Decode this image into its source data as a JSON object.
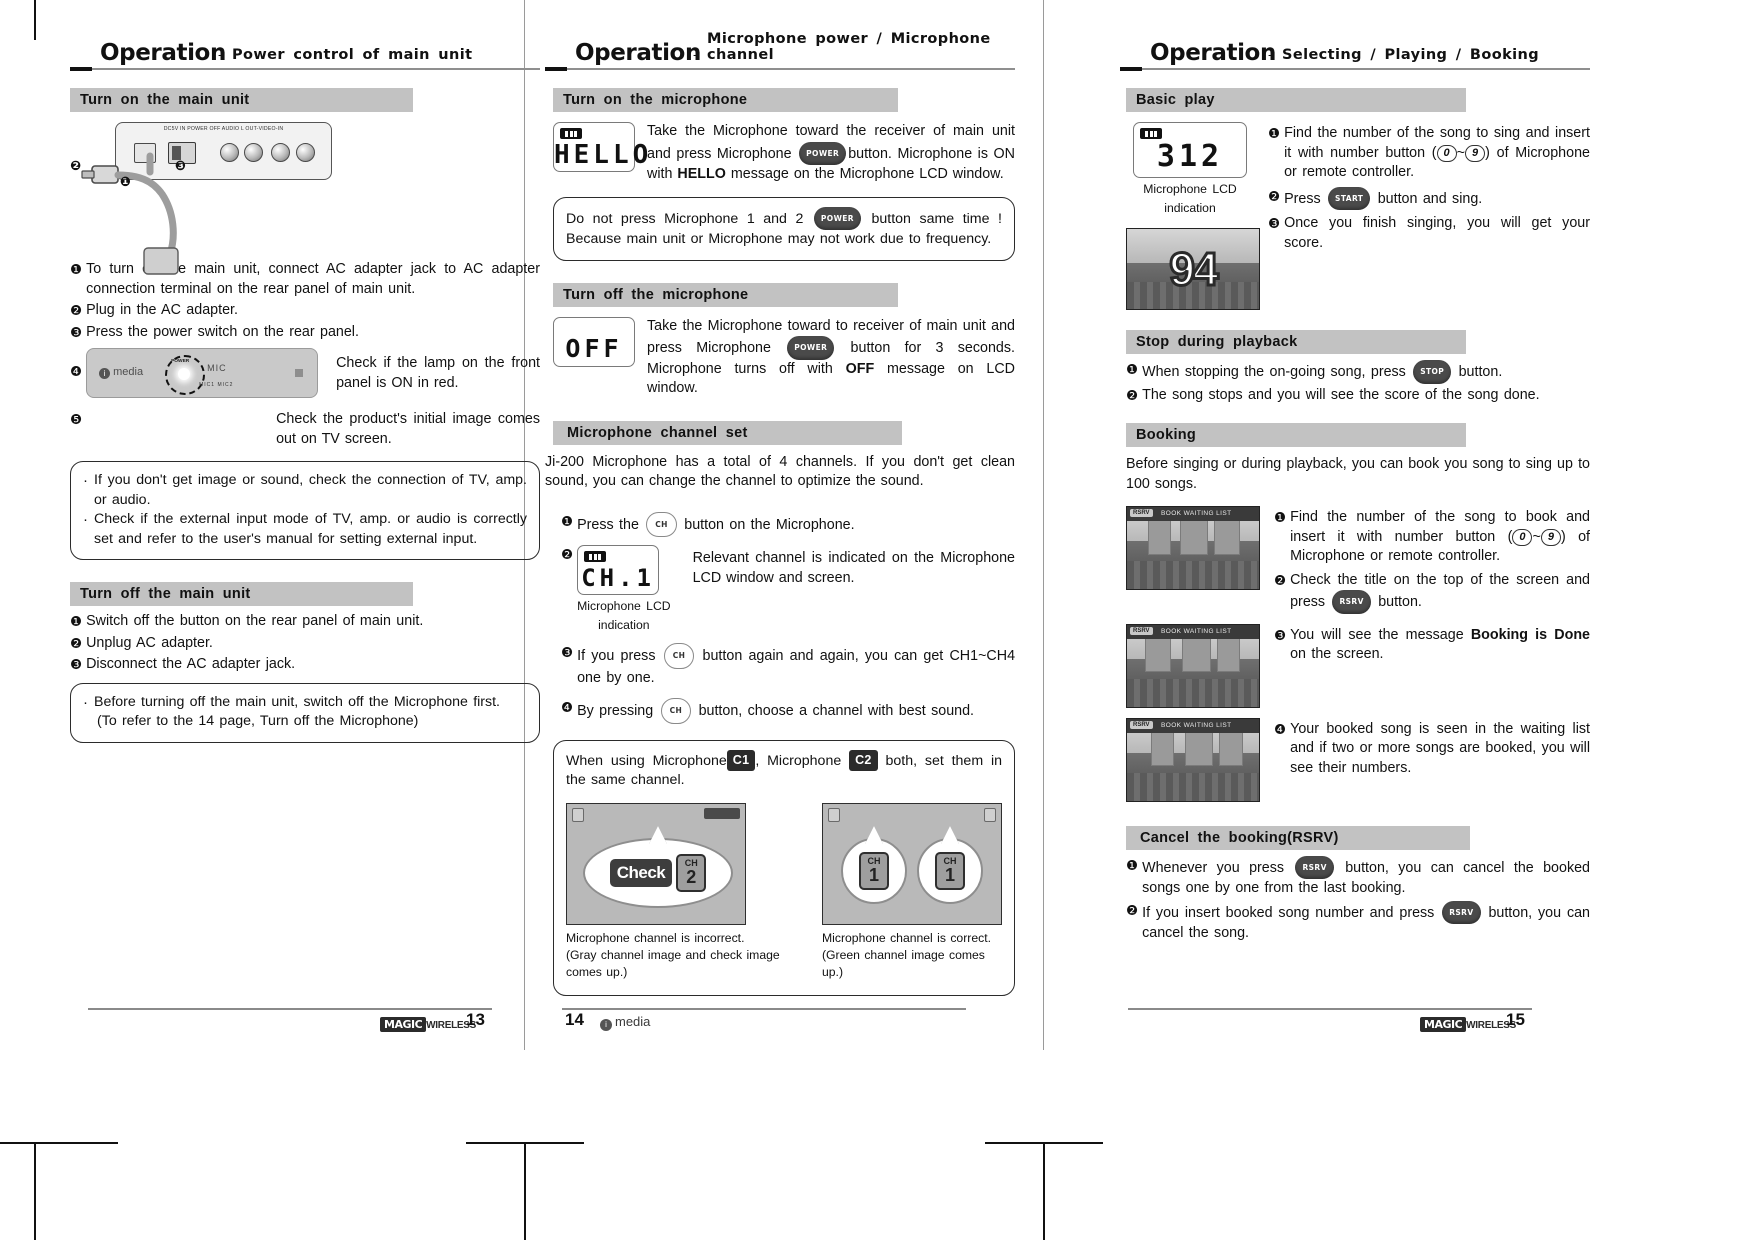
{
  "page13": {
    "header": {
      "title": "Operation",
      "dash": "-",
      "subtitle": "Power control of main unit"
    },
    "section_on": "Turn on the main unit",
    "steps_on": [
      "To turn on the main unit, connect AC adapter jack to AC adapter connection terminal on the rear panel of main unit.",
      "Plug in the AC adapter.",
      "Press the power switch on the rear panel.",
      "Check if the lamp on the front panel is ON in red.",
      "Check the product's initial image comes out on TV screen."
    ],
    "rear_panel_labels": "DC5V IN   POWER  OFF      AUDIO  L      OUT-VIDEO-IN",
    "front_panel": {
      "brand": "media",
      "power_label": "POWER",
      "mic_label": "MIC",
      "mic_sub": "MIC1  MIC2"
    },
    "note_on": [
      "If you don't get image or sound, check the connection of TV, amp. or audio.",
      "Check if the external input mode of TV, amp. or audio is correctly set and refer to the user's manual for setting external input."
    ],
    "section_off": "Turn off the main unit",
    "steps_off": [
      "Switch off the button on the rear panel of main unit.",
      "Unplug AC adapter.",
      "Disconnect the AC adapter jack."
    ],
    "note_off_line1": "Before turning off the main unit, switch off the Microphone first.",
    "note_off_line2": "(To refer to the 14 page, Turn off the Microphone)",
    "footer": {
      "brand": "MAGIC",
      "brand2": "WIRELESS",
      "number": "13"
    }
  },
  "page14": {
    "header": {
      "title": "Operation",
      "dash": "-",
      "subtitle": "Microphone power / Microphone channel"
    },
    "section_mic_on": "Turn on the microphone",
    "lcd_hello": "HELLO",
    "mic_on_text_a": "Take the Microphone toward the receiver of main unit and press Microphone",
    "mic_on_button": "POWER",
    "mic_on_text_b": "button. Microphone is ON with",
    "mic_on_bold": "HELLO",
    "mic_on_text_c": "message on the Microphone LCD window.",
    "note_mic_a": "Do not press Microphone 1 and 2",
    "note_mic_button": "POWER",
    "note_mic_b": "button same time ! Because main unit or Microphone may not work due to frequency.",
    "section_mic_off": "Turn off the microphone",
    "lcd_off": "OFF",
    "mic_off_text_a": "Take the Microphone toward to receiver of main unit and press Microphone",
    "mic_off_button": "POWER",
    "mic_off_text_b": "button for 3 seconds. Microphone turns off with",
    "mic_off_bold": "OFF",
    "mic_off_text_c": "message on LCD window.",
    "section_channel": "Microphone channel set",
    "channel_intro": "Ji-200 Microphone has a total of 4 channels. If you don't get clean sound, you can change the channel to optimize the sound.",
    "ch_button": "CH",
    "ch_steps": [
      {
        "a": "Press the",
        "b": "button on the Microphone."
      },
      {
        "a": "Relevant channel is indicated on the Microphone LCD window and screen.",
        "b": ""
      },
      {
        "a": "If you press",
        "b": "button again and again, you can get CH1~CH4 one by one."
      },
      {
        "a": "By pressing",
        "b": "button, choose a channel with best sound."
      }
    ],
    "lcd_ch": "CH.1",
    "lcd_caption_line1": "Microphone  LCD",
    "lcd_caption_line2": "indication",
    "cmp_intro_a": "When using Microphone",
    "cmp_tag1": "C1",
    "cmp_intro_b": ", Microphone",
    "cmp_tag2": "C2",
    "cmp_intro_c": "both, set them in the same channel.",
    "cmp_left": {
      "check": "Check",
      "ch": "CH",
      "n": "2",
      "caption1": "Microphone channel is incorrect.",
      "caption2": "(Gray channel image and check image comes up.)"
    },
    "cmp_right": {
      "ch": "CH",
      "n1": "1",
      "n2": "1",
      "caption1": "Microphone channel is correct.",
      "caption2": "(Green channel image comes up.)"
    },
    "footer": {
      "number": "14",
      "brand": "media"
    }
  },
  "page15": {
    "header": {
      "title": "Operation",
      "dash": "-",
      "subtitle": "Selecting / Playing / Booking"
    },
    "section_basic": "Basic play",
    "lcd_number": "312",
    "lcd_caption_line1": "Microphone  LCD",
    "lcd_caption_line2": "indication",
    "score": "94",
    "basic_steps": [
      {
        "a": "Find the number of the song to sing and insert it with number button (",
        "k1": "0",
        "tilde": "~",
        "k2": "9",
        "b": ") of Microphone or remote controller."
      },
      {
        "a": "Press",
        "btn": "START",
        "b": "button and sing."
      },
      {
        "a": "Once you finish singing, you will get your score.",
        "b": ""
      }
    ],
    "section_stop": "Stop during playback",
    "stop_steps": [
      {
        "a": "When stopping the on-going song, press",
        "btn": "STOP",
        "b": "button."
      },
      {
        "a": "The song stops and you will see the score of the song done.",
        "b": ""
      }
    ],
    "section_booking": "Booking",
    "booking_intro": "Before singing or during playback, you can book you song to sing up to 100 songs.",
    "booking_steps": [
      {
        "a": "Find the number of the song to book and insert it with number button (",
        "k1": "0",
        "tilde": "~",
        "k2": "9",
        "b": ") of Microphone or remote controller."
      },
      {
        "a": "Check the title on the top of the screen and press",
        "btn": "RSRV",
        "b": "button."
      },
      {
        "a": "You will see the message",
        "bold": "Booking is Done",
        "b": "on the screen."
      },
      {
        "a": "Your booked song is seen in the waiting list and if two or more songs are booked, you will see their numbers.",
        "b": ""
      }
    ],
    "video_tag": "RSRV",
    "video_title": "BOOK  WAITING  LIST",
    "section_cancel": "Cancel the booking(RSRV)",
    "cancel_steps": [
      {
        "a": "Whenever you press",
        "btn": "RSRV",
        "b": "button, you can cancel the booked songs one by one from the last booking."
      },
      {
        "a": "If you insert booked song number and press",
        "btn": "RSRV",
        "b": "button, you can cancel the song."
      }
    ],
    "footer": {
      "brand": "MAGIC",
      "brand2": "WIRELESS",
      "number": "15"
    }
  },
  "numerals": [
    "❶",
    "❷",
    "❸",
    "❹",
    "❺"
  ],
  "colors": {
    "bar": "#c2c2c2",
    "rule": "#8a8a8a",
    "text": "#111111"
  }
}
